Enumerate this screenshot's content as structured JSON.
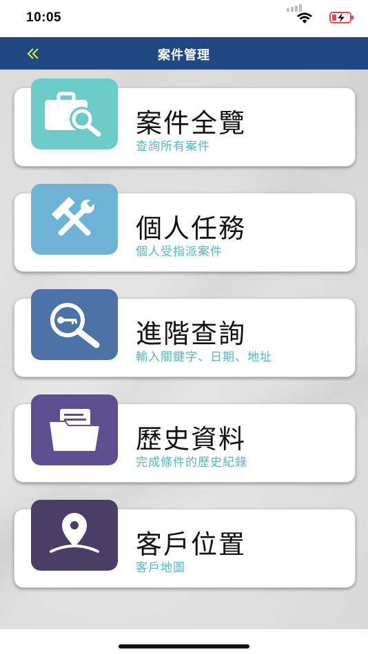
{
  "status": {
    "time": "10:05"
  },
  "nav": {
    "back_icon": "double-chevron-left-icon",
    "title": "案件管理"
  },
  "menu": [
    {
      "title": "案件全覽",
      "subtitle": "查詢所有案件",
      "icon": "briefcase-search-icon",
      "color": "#6ccbc7"
    },
    {
      "title": "個人任務",
      "subtitle": "個人受指派案件",
      "icon": "tools-icon",
      "color": "#6cb3d5"
    },
    {
      "title": "進階查詢",
      "subtitle": "輸入關鍵字、日期、地址",
      "icon": "key-search-icon",
      "color": "#4c72a6"
    },
    {
      "title": "歷史資料",
      "subtitle": "完成條件的歷史紀錄",
      "icon": "folder-icon",
      "color": "#5e4e90"
    },
    {
      "title": "客戶位置",
      "subtitle": "客戶地圖",
      "icon": "location-pin-icon",
      "color": "#4b3d66"
    }
  ],
  "colors": {
    "navbar": "#1f4882",
    "back_icon": "#dff542",
    "subtitle": "#55b7c3"
  }
}
